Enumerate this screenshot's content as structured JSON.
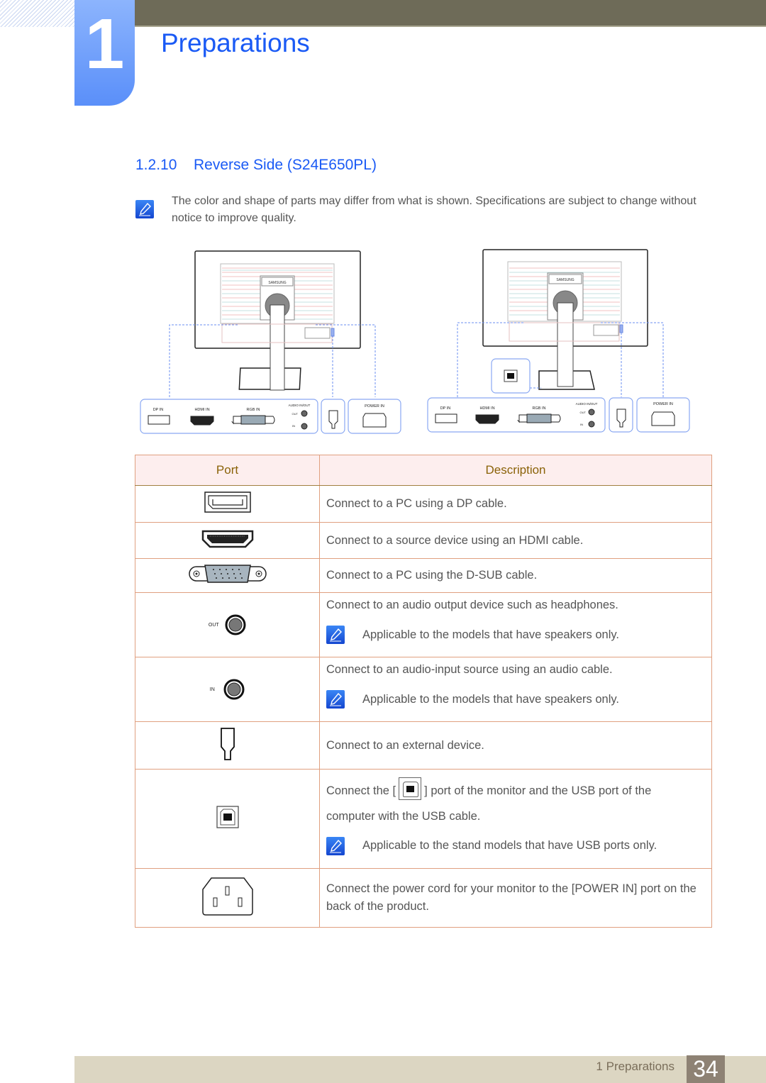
{
  "header": {
    "chapter_number": "1",
    "chapter_title": "Preparations"
  },
  "section": {
    "number": "1.2.10",
    "title": "Reverse Side (S24E650PL)"
  },
  "top_note": {
    "icon": "note-pencil-icon",
    "text": "The color and shape of parts may differ from what is shown. Specifications are subject to change without notice to improve quality."
  },
  "diagrams": [
    {
      "variant": "without-usb-stand",
      "brand": "SAMSUNG",
      "panel_labels": {
        "dp": "DP IN",
        "hdmi": "HDMI IN",
        "rgb": "RGB IN",
        "audio": "AUDIO IN/OUT",
        "audio_out": "OUT",
        "audio_in": "IN",
        "power": "POWER IN"
      }
    },
    {
      "variant": "with-usb-stand",
      "brand": "SAMSUNG",
      "panel_labels": {
        "dp": "DP IN",
        "hdmi": "HDMI IN",
        "rgb": "RGB IN",
        "audio": "AUDIO IN/OUT",
        "audio_out": "OUT",
        "audio_in": "IN",
        "power": "POWER IN"
      }
    }
  ],
  "table": {
    "headers": {
      "port": "Port",
      "description": "Description"
    },
    "rows": [
      {
        "port_icon": "displayport-icon",
        "description": "Connect to a PC using a DP cable."
      },
      {
        "port_icon": "hdmi-port-icon",
        "description": "Connect to a source device using an HDMI cable."
      },
      {
        "port_icon": "dsub-port-icon",
        "description": "Connect to a PC using the D-SUB cable."
      },
      {
        "port_icon": "audio-out-jack-icon",
        "port_label": "OUT",
        "description": "Connect to an audio output device such as headphones.",
        "note": "Applicable to the models that have speakers only."
      },
      {
        "port_icon": "audio-in-jack-icon",
        "port_label": "IN",
        "description": "Connect to an audio-input source using an audio cable.",
        "note": "Applicable to the models that have speakers only."
      },
      {
        "port_icon": "external-device-port-icon",
        "description": "Connect to an external device."
      },
      {
        "port_icon": "usb-b-port-icon",
        "description_before": "Connect the [",
        "description_after": "] port of the monitor and the USB port of the",
        "description_line2": "computer with the USB cable.",
        "note": "Applicable to the stand models that have USB ports only."
      },
      {
        "port_icon": "power-in-port-icon",
        "description": "Connect the power cord for your monitor to the [POWER IN] port on the back of the product."
      }
    ]
  },
  "footer": {
    "label": "1 Preparations",
    "page_number": "34"
  },
  "colors": {
    "accent_blue": "#1a5af5",
    "header_bar": "#6e6b58",
    "table_header_text": "#8a6208",
    "table_header_bg": "#fdeeee",
    "footer_bar": "#dcd6c2",
    "page_badge": "#8e8274"
  }
}
